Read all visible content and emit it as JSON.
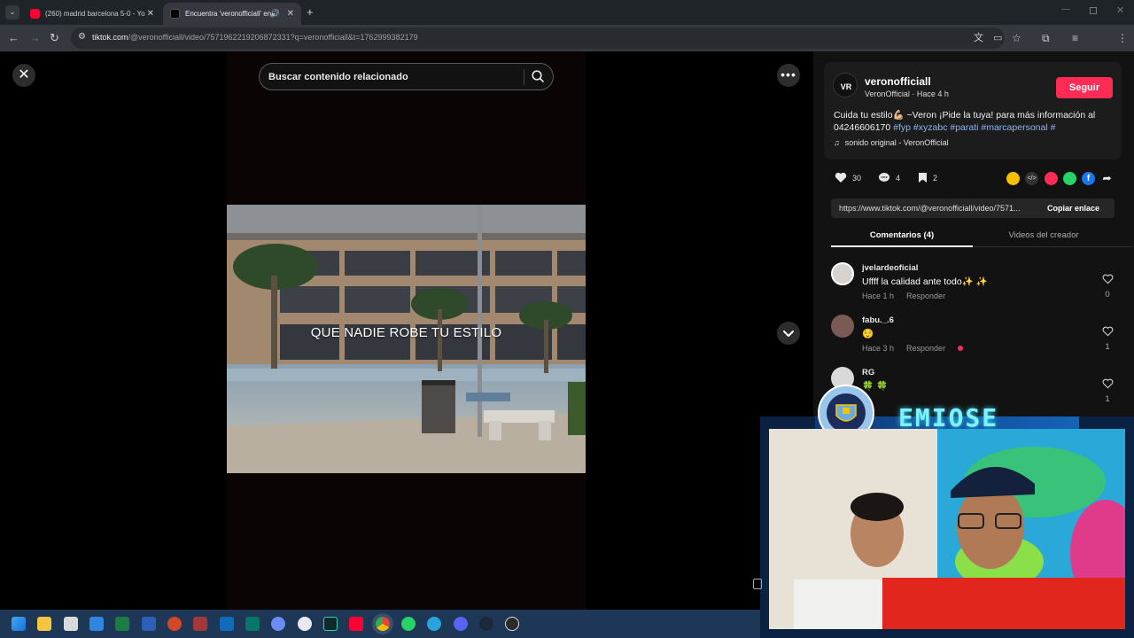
{
  "browser": {
    "tabs": [
      {
        "title": "(260) madrid barcelona 5-0 - Yo",
        "favicon_color": "#ff0033"
      },
      {
        "title": "Encuentra 'veronofficiall' en",
        "favicon_color": "#000000"
      }
    ],
    "url_host": "tiktok.com",
    "url_path": "/@veronofficiall/video/7571962219206872331?q=veronofficiall&t=1762999382179"
  },
  "search": {
    "placeholder": "Buscar contenido relacionado"
  },
  "video": {
    "caption": "QUE NADIE ROBE TU ESTILO"
  },
  "author": {
    "username": "veronofficiall",
    "display_line": "VeronOfficial · Hace 4 h",
    "follow_label": "Seguir",
    "description": "Cuida tu estilo💪🏼 ~Veron ¡Pide la tuya! para más información al 04246606170 ",
    "hashtags": "#fyp #xyzabc #parati #marcapersonal #",
    "sound": "sonido original - VeronOfficial"
  },
  "stats": {
    "likes": "30",
    "comments": "4",
    "saves": "2"
  },
  "share_link": {
    "url": "https://www.tiktok.com/@veronofficiall/video/7571...",
    "copy_label": "Copiar enlace"
  },
  "panel_tabs": {
    "comments": "Comentarios (4)",
    "creator_videos": "Videos del creador"
  },
  "comments": [
    {
      "user": "jvelardeoficial",
      "text": "Uffff la calidad ante todo✨ ✨",
      "time": "Hace 1 h",
      "reply": "Responder",
      "likes": "0"
    },
    {
      "user": "fabu._.6",
      "text": "😌",
      "time": "Hace 3 h",
      "reply": "Responder",
      "likes": "1"
    },
    {
      "user": "RG",
      "text": "🍀 🍀",
      "likes": "1"
    }
  ],
  "overlay": {
    "stream_title": "EMIOSE"
  },
  "colors": {
    "brand_accent": "#fe2c55",
    "hashtag": "#8ab4f8",
    "panel_bg": "#121212"
  }
}
